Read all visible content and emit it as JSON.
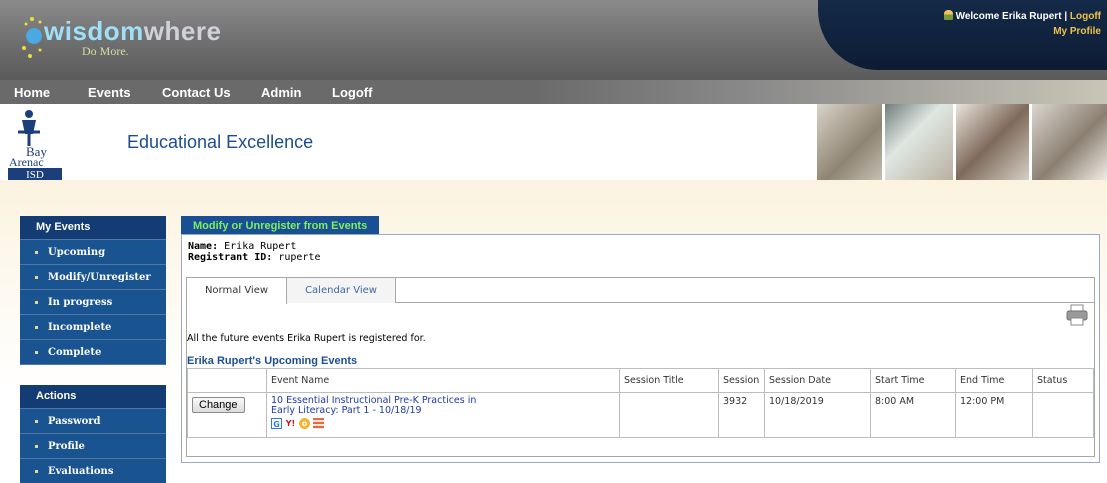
{
  "header": {
    "logo_word_1": "wisdom",
    "logo_word_2": "where",
    "logo_tagline": "Do More.",
    "welcome_text": "Welcome Erika Rupert",
    "separator": "|",
    "logoff_link": "Logoff",
    "my_profile_link": "My Profile"
  },
  "nav": {
    "items": [
      "Home",
      "Events",
      "Contact Us",
      "Admin",
      "Logoff"
    ]
  },
  "banner": {
    "logo_text_1": "Bay",
    "logo_text_2": "Arenac",
    "logo_text_3": "ISD",
    "title": "Educational Excellence"
  },
  "sidebar": {
    "my_events": {
      "heading": "My Events",
      "items": [
        "Upcoming",
        "Modify/Unregister",
        "In progress",
        "Incomplete",
        "Complete"
      ]
    },
    "actions": {
      "heading": "Actions",
      "items": [
        "Password",
        "Profile",
        "Evaluations"
      ]
    }
  },
  "main": {
    "panel_title": "Modify or Unregister from Events",
    "name_label": "Name:",
    "name_value": "Erika Rupert",
    "registrant_label": "Registrant ID:",
    "registrant_value": "ruperte",
    "tabs": [
      "Normal View",
      "Calendar View"
    ],
    "intro_text": "All the future events Erika Rupert is registered for.",
    "table_heading": "Erika Rupert's Upcoming Events",
    "columns": [
      "",
      "Event Name",
      "Session Title",
      "Session",
      "Session Date",
      "Start Time",
      "End Time",
      "Status"
    ],
    "rows": [
      {
        "button": "Change",
        "event_name_line1": "10 Essential Instructional Pre-K Practices in",
        "event_name_line2": "Early Literacy: Part 1 - 10/18/19",
        "session_title": "",
        "session": "3932",
        "session_date": "10/18/2019",
        "start_time": "8:00 AM",
        "end_time": "12:00 PM",
        "status": ""
      }
    ],
    "calendar_icons": [
      "google-calendar-icon",
      "yahoo-calendar-icon",
      "outlook-calendar-icon",
      "ical-icon"
    ]
  },
  "colors": {
    "nav_bg": "#6a6a6a",
    "sidebar_bg": "#1a5490",
    "panel_title_bg": "#1b4f95",
    "panel_title_text": "#7ef05a",
    "link_blue": "#1f3aa5"
  }
}
